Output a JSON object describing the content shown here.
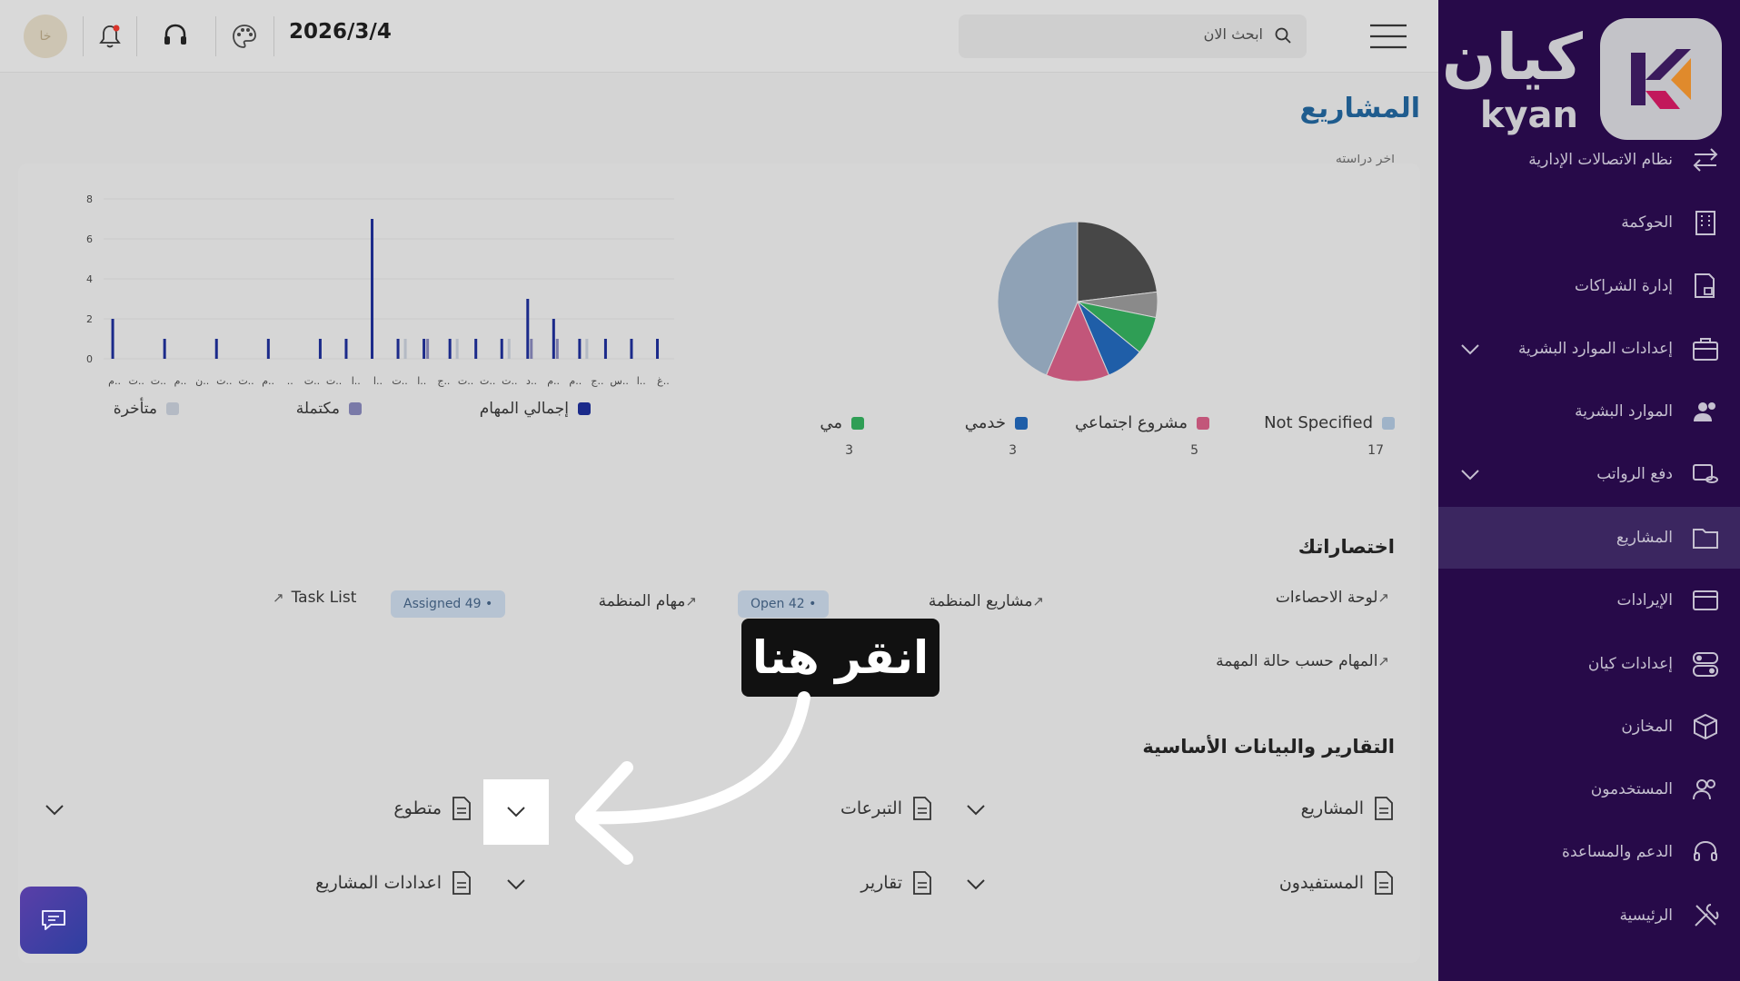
{
  "header": {
    "date": "2026/3/4",
    "search_placeholder": "ابحث الان",
    "avatar_initials": "خا"
  },
  "page_title": "المشاريع",
  "brand": {
    "name_ar": "كيان",
    "name_en": "kyan",
    "accent_orange": "#e08a2c",
    "accent_magenta": "#c2185b"
  },
  "sidebar": {
    "items": [
      {
        "label": "نظام الاتصالات الإدارية",
        "icon": "arrows-exchange-icon"
      },
      {
        "label": "الحوكمة",
        "icon": "building-icon"
      },
      {
        "label": "إدارة الشراكات",
        "icon": "document-lock-icon"
      },
      {
        "label": "إعدادات الموارد البشرية",
        "icon": "briefcase-icon"
      },
      {
        "label": "الموارد البشرية",
        "icon": "users-icon"
      },
      {
        "label": "دفع الرواتب",
        "icon": "payroll-icon"
      },
      {
        "label": "المشاريع",
        "icon": "folder-icon"
      },
      {
        "label": "الإيرادات",
        "icon": "card-icon"
      },
      {
        "label": "إعدادات كيان",
        "icon": "toggle-icon"
      },
      {
        "label": "المخازن",
        "icon": "box-icon"
      },
      {
        "label": "المستخدمون",
        "icon": "user-group-icon"
      },
      {
        "label": "الدعم والمساعدة",
        "icon": "headset-icon"
      },
      {
        "label": "الرئيسية",
        "icon": "tools-icon"
      }
    ]
  },
  "pie_partial_label": "آخر دراسته",
  "pie_legend": [
    {
      "label": "Not Specified",
      "count": "17",
      "color": "#9fb3c8"
    },
    {
      "label": "مشروع اجتماعي",
      "count": "5",
      "color": "#c2567a"
    },
    {
      "label": "خدمي",
      "count": "3",
      "color": "#1f5ea8"
    },
    {
      "label": "مي",
      "count": "3",
      "color": "#2f9e55"
    }
  ],
  "bar_legend": [
    {
      "label": "إجمالي المهام",
      "color": "#1b2a8a"
    },
    {
      "label": "مكتملة",
      "color": "#7a7aa8"
    },
    {
      "label": "متأخرة",
      "color": "#b4bac4"
    }
  ],
  "chart_data": [
    {
      "type": "pie",
      "values": [
        17,
        5,
        3,
        3,
        9,
        2
      ],
      "colors": [
        "#8fa2b6",
        "#c2567a",
        "#1f5ea8",
        "#2f9e55",
        "#474747",
        "#8a8a8a"
      ]
    },
    {
      "type": "bar",
      "ylim": [
        0,
        8
      ],
      "yticks": [
        "0",
        "2",
        "4",
        "6",
        "8"
      ],
      "x_tick_labels": [
        "م..",
        "ت..",
        "ت..",
        "م..",
        "ن..",
        "ت..",
        "ت..",
        "م..",
        "..",
        "ت..",
        "ت..",
        "ا..",
        "ا..",
        "ت..",
        "ا..",
        "ج..",
        "ت..",
        "ت..",
        "ت..",
        "د..",
        "م..",
        "م..",
        "ج..",
        "س..",
        "ا..",
        "غ.."
      ],
      "series": [
        {
          "name": "إجمالي المهام",
          "values": [
            2,
            0,
            1,
            0,
            1,
            0,
            1,
            0,
            1,
            1,
            7,
            1,
            1,
            1,
            1,
            1,
            3,
            2,
            1,
            1,
            1,
            1
          ]
        },
        {
          "name": "مكتملة",
          "values": [
            0,
            0,
            0,
            0,
            0,
            0,
            0,
            0,
            0,
            0,
            0,
            0,
            1,
            0,
            0,
            0,
            1,
            1,
            0,
            0,
            0,
            0
          ]
        },
        {
          "name": "متأخرة",
          "values": [
            0,
            0,
            0,
            0,
            0,
            0,
            0,
            0,
            0,
            0,
            0,
            1,
            0,
            1,
            0,
            1,
            0,
            0,
            1,
            0,
            0,
            0
          ]
        }
      ]
    }
  ],
  "shortcuts": {
    "title": "اختصاراتك",
    "items": [
      {
        "label": "لوحة الاحصاءات"
      },
      {
        "label": "مشاريع المنظمة"
      },
      {
        "label": "مهام المنظمة"
      },
      {
        "label": "Task List"
      },
      {
        "label": "المهام حسب حالة المهمة"
      }
    ],
    "badges": [
      {
        "label": "Open 42"
      },
      {
        "label": "Assigned 49"
      }
    ]
  },
  "reports": {
    "title": "التقارير والبيانات الأساسية",
    "items": [
      {
        "label": "المشاريع"
      },
      {
        "label": "التبرعات"
      },
      {
        "label": "متطوع"
      },
      {
        "label": "المستفيدون"
      },
      {
        "label": "تقارير"
      },
      {
        "label": "اعدادات المشاريع"
      }
    ]
  },
  "tooltip": {
    "text": "انقر هنا"
  }
}
